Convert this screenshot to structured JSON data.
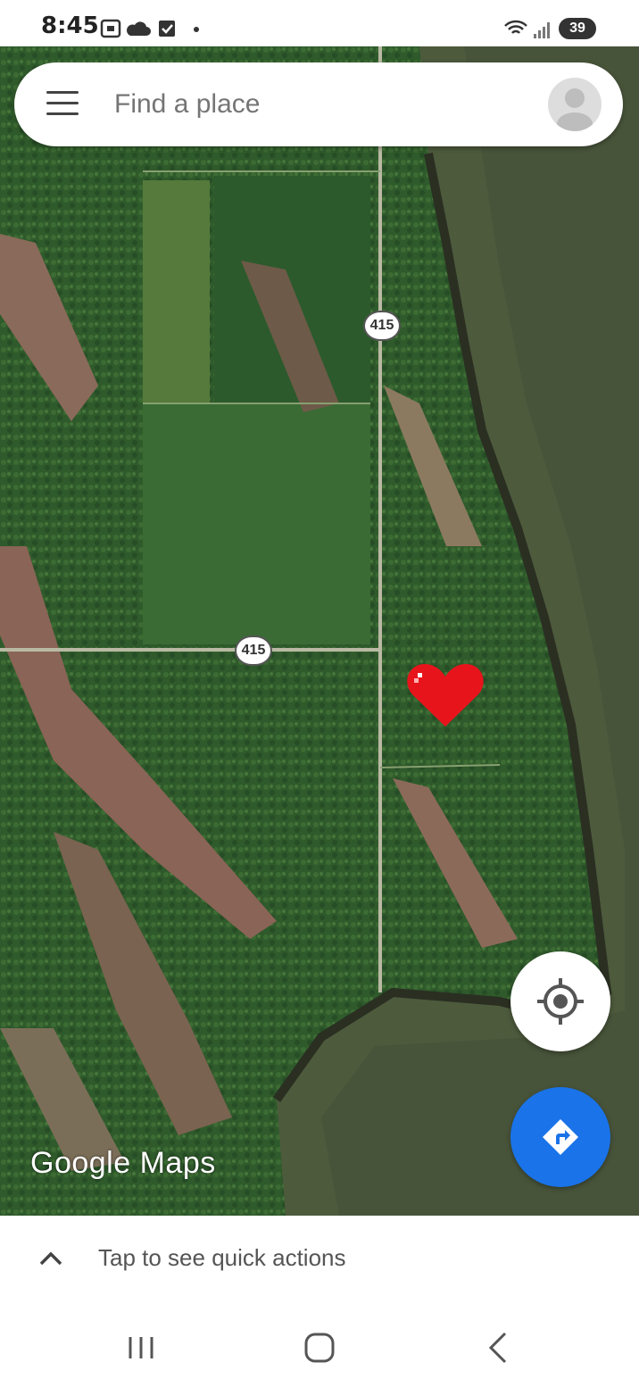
{
  "status_bar": {
    "time": "8:45",
    "battery": "39",
    "icons": [
      "screenshot-icon",
      "cloud-icon",
      "checkbox-icon",
      "dot-icon",
      "wifi-icon",
      "signal-icon",
      "battery-icon"
    ]
  },
  "search": {
    "placeholder": "Find a place",
    "menu_icon": "hamburger-menu-icon",
    "avatar_icon": "account-avatar-icon"
  },
  "map": {
    "route_labels": [
      "415",
      "415"
    ],
    "marker_icon": "heart-marker-icon",
    "logo_text": "Google Maps"
  },
  "buttons": {
    "my_location_icon": "my-location-icon",
    "directions_icon": "directions-icon"
  },
  "quick_actions": {
    "label": "Tap to see quick actions",
    "icon": "chevron-up-icon"
  },
  "nav_bar": {
    "items": [
      "recent-apps-icon",
      "home-icon",
      "back-icon"
    ]
  },
  "colors": {
    "accent": "#1a73e8",
    "marker": "#e8141c"
  }
}
